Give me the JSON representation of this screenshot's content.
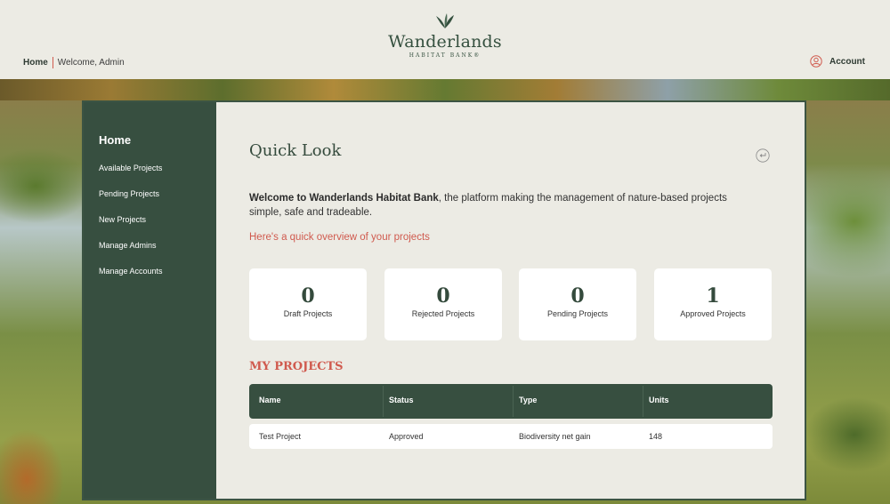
{
  "header": {
    "breadcrumb_home": "Home",
    "welcome": "Welcome, Admin",
    "brand_name": "Wanderlands",
    "brand_sub": "HABITAT BANK®",
    "account_label": "Account"
  },
  "sidebar": {
    "home": "Home",
    "items": [
      {
        "label": "Available Projects"
      },
      {
        "label": "Pending Projects"
      },
      {
        "label": "New Projects"
      },
      {
        "label": "Manage Admins"
      },
      {
        "label": "Manage Accounts"
      }
    ]
  },
  "main": {
    "title": "Quick Look",
    "intro_bold": "Welcome to Wanderlands Habitat Bank",
    "intro_rest": ", the platform making the management of nature-based projects simple, safe and tradeable.",
    "overview_link": "Here's a quick overview of your projects",
    "stats": [
      {
        "value": "0",
        "label": "Draft Projects"
      },
      {
        "value": "0",
        "label": "Rejected Projects"
      },
      {
        "value": "0",
        "label": "Pending Projects"
      },
      {
        "value": "1",
        "label": "Approved Projects"
      }
    ],
    "my_projects_heading": "MY PROJECTS",
    "table": {
      "headers": [
        "Name",
        "Status",
        "Type",
        "Units"
      ],
      "rows": [
        [
          "Test Project",
          "Approved",
          "Biodiversity net gain",
          "148"
        ]
      ]
    }
  },
  "colors": {
    "primary_green": "#374f40",
    "accent_red": "#d05a4e",
    "background": "#ecebe4"
  },
  "icons": {
    "brand": "leaf-icon",
    "account": "user-circle-icon",
    "back": "return-arrow-icon"
  }
}
